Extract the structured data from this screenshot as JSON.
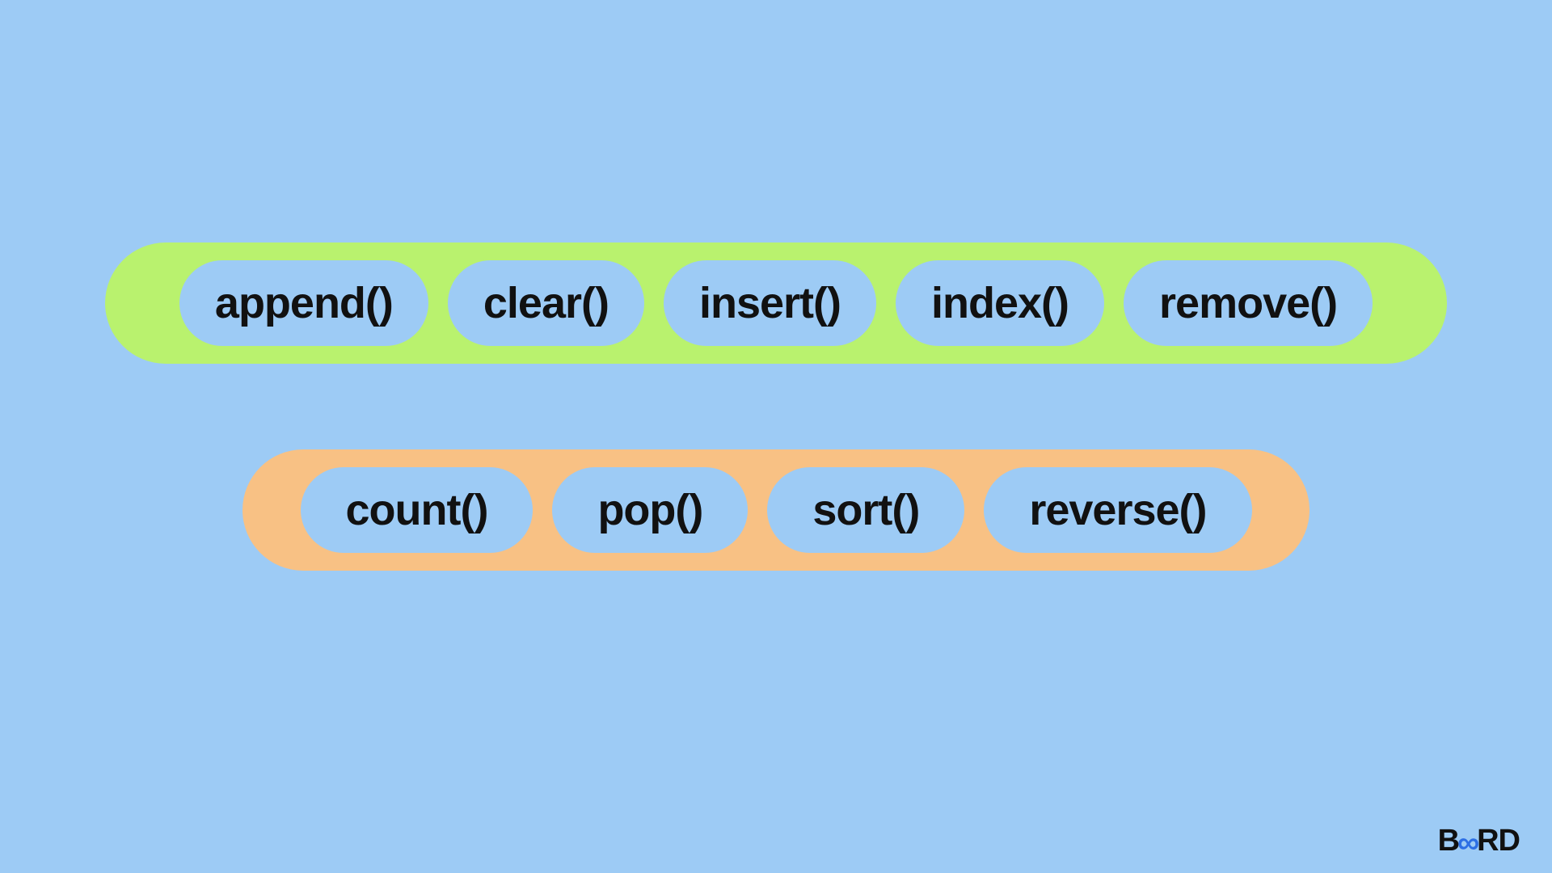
{
  "groups": [
    {
      "id": "group-green",
      "color": "green",
      "items": [
        {
          "label": "append()"
        },
        {
          "label": "clear()"
        },
        {
          "label": "insert()"
        },
        {
          "label": "index()"
        },
        {
          "label": "remove()"
        }
      ]
    },
    {
      "id": "group-orange",
      "color": "orange",
      "items": [
        {
          "label": "count()"
        },
        {
          "label": "pop()"
        },
        {
          "label": "sort()"
        },
        {
          "label": "reverse()"
        }
      ]
    }
  ],
  "brand": {
    "part1": "B",
    "infinity": "∞",
    "part2": "RD"
  }
}
